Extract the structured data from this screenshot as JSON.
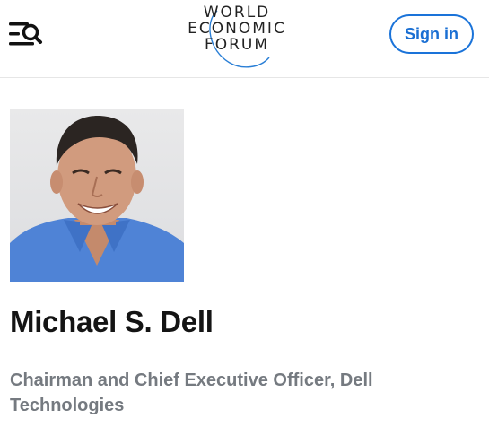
{
  "header": {
    "logo": {
      "line1": "WORLD",
      "line2": "ECONOMIC",
      "line3": "FORUM"
    },
    "menu_icon": "menu-search-icon",
    "sign_in_label": "Sign in"
  },
  "profile": {
    "name": "Michael S. Dell",
    "title": "Chairman and Chief Executive Officer, Dell Technologies"
  },
  "colors": {
    "accent": "#1a73d9",
    "title_text": "#757a80",
    "name_text": "#141414"
  }
}
